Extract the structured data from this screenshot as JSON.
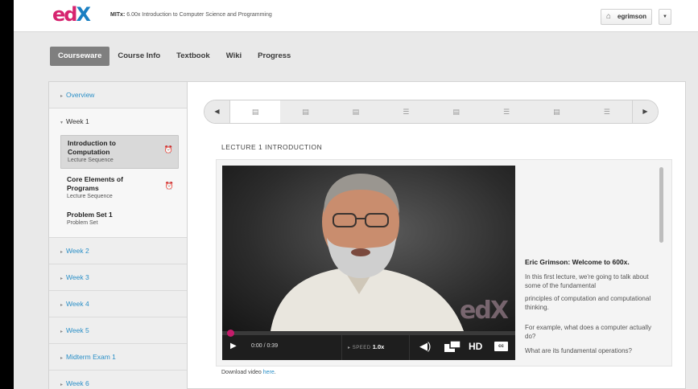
{
  "header": {
    "course_code": "MITx:",
    "course_title": "6.00x Introduction to Computer Science and Programming",
    "username": "egrimson"
  },
  "nav": {
    "tabs": [
      {
        "label": "Courseware",
        "active": true
      },
      {
        "label": "Course Info"
      },
      {
        "label": "Textbook"
      },
      {
        "label": "Wiki"
      },
      {
        "label": "Progress"
      }
    ]
  },
  "sidebar": {
    "overview": "Overview",
    "week1": "Week 1",
    "sections": [
      {
        "title": "Introduction to Computation",
        "subtitle": "Lecture Sequence",
        "active": true,
        "alarm": true
      },
      {
        "title": "Core Elements of Programs",
        "subtitle": "Lecture Sequence",
        "alarm": true
      },
      {
        "title": "Problem Set 1",
        "subtitle": "Problem Set"
      }
    ],
    "chapters": [
      "Week 2",
      "Week 3",
      "Week 4",
      "Week 5",
      "Midterm Exam 1",
      "Week 6"
    ]
  },
  "main": {
    "unit_title": "LECTURE 1 INTRODUCTION",
    "sequence_icons": [
      "video-icon",
      "video-icon",
      "video-icon",
      "problem-icon",
      "video-icon",
      "problem-icon",
      "video-icon",
      "problem-icon"
    ],
    "video": {
      "time": "0:00 / 0:39",
      "speed_label": "SPEED",
      "speed_value": "1.0x",
      "hd_label": "HD",
      "cc_label": "cc",
      "watermark": "edX"
    },
    "transcript": {
      "title": "Eric Grimson: Welcome to 600x.",
      "lines": [
        "In this first lecture, we're going to talk about some of the fundamental",
        "principles of computation and computational thinking.",
        "For example, what does a computer actually do?",
        "What are its fundamental operations?"
      ]
    },
    "download_text": "Download video",
    "download_link": "here"
  },
  "colors": {
    "brand_pink": "#d6246f",
    "brand_blue": "#1a7fc2",
    "link_blue": "#2a8fc7"
  }
}
